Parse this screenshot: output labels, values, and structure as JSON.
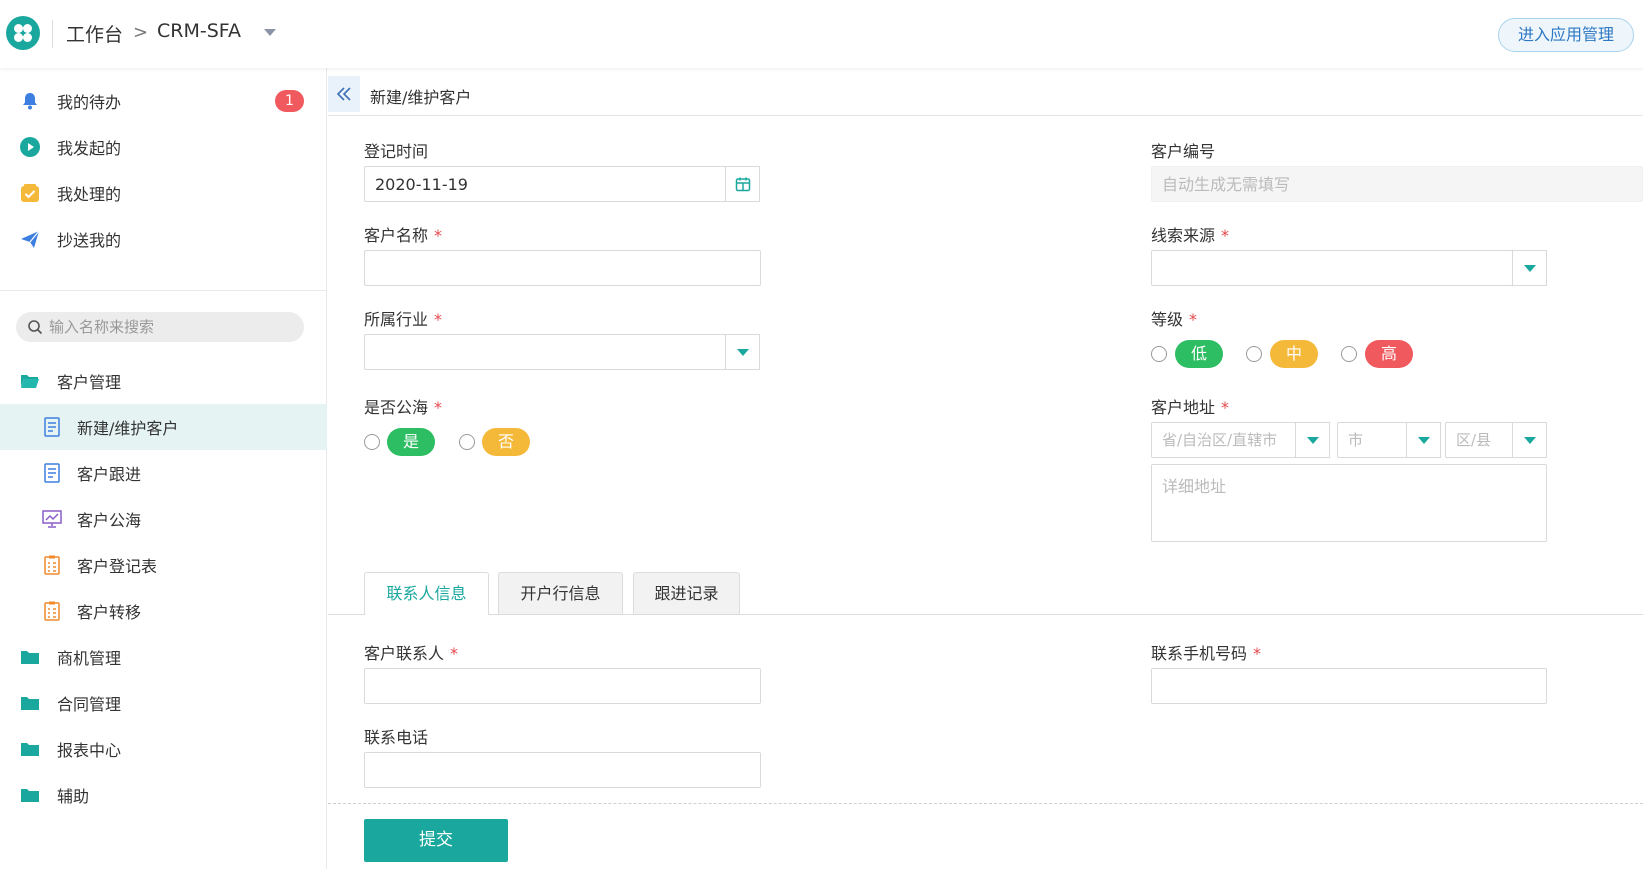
{
  "header": {
    "home": "工作台",
    "separator": ">",
    "app": "CRM-SFA",
    "manage_button": "进入应用管理"
  },
  "sidebar": {
    "quick": [
      {
        "label": "我的待办",
        "icon": "bell-icon",
        "badge": "1"
      },
      {
        "label": "我发起的",
        "icon": "play-icon"
      },
      {
        "label": "我处理的",
        "icon": "check-box-icon"
      },
      {
        "label": "抄送我的",
        "icon": "paper-plane-icon"
      }
    ],
    "search_placeholder": "输入名称来搜索",
    "groups": [
      {
        "label": "客户管理",
        "icon": "folder-open-icon"
      },
      {
        "label": "新建/维护客户",
        "icon": "form-icon",
        "active": true
      },
      {
        "label": "客户跟进",
        "icon": "form-icon"
      },
      {
        "label": "客户公海",
        "icon": "report-icon"
      },
      {
        "label": "客户登记表",
        "icon": "table-icon"
      },
      {
        "label": "客户转移",
        "icon": "table-icon"
      },
      {
        "label": "商机管理",
        "icon": "folder-icon"
      },
      {
        "label": "合同管理",
        "icon": "folder-icon"
      },
      {
        "label": "报表中心",
        "icon": "folder-icon"
      },
      {
        "label": "辅助",
        "icon": "folder-icon"
      }
    ]
  },
  "page": {
    "title": "新建/维护客户",
    "collapse_icon": "double-chevron-left-icon"
  },
  "form": {
    "register_time": {
      "label": "登记时间",
      "value": "2020-11-19"
    },
    "customer_no": {
      "label": "客户编号",
      "placeholder": "自动生成无需填写"
    },
    "customer_name": {
      "label": "客户名称",
      "required": "*"
    },
    "lead_source": {
      "label": "线索来源",
      "required": "*"
    },
    "industry": {
      "label": "所属行业",
      "required": "*"
    },
    "level": {
      "label": "等级",
      "required": "*",
      "options": [
        "低",
        "中",
        "高"
      ]
    },
    "public_sea": {
      "label": "是否公海",
      "required": "*",
      "options": [
        "是",
        "否"
      ]
    },
    "address": {
      "label": "客户地址",
      "required": "*",
      "province_placeholder": "省/自治区/直辖市",
      "city_placeholder": "市",
      "district_placeholder": "区/县",
      "detail_placeholder": "详细地址"
    }
  },
  "tabs": [
    "联系人信息",
    "开户行信息",
    "跟进记录"
  ],
  "contact": {
    "contact_person": {
      "label": "客户联系人",
      "required": "*"
    },
    "mobile": {
      "label": "联系手机号码",
      "required": "*"
    },
    "phone": {
      "label": "联系电话"
    }
  },
  "submit_label": "提交",
  "colors": {
    "primary": "#1aa89e",
    "low": "#2dbd62",
    "mid": "#f5b93a",
    "high": "#f0595d",
    "badge": "#f0595d"
  }
}
